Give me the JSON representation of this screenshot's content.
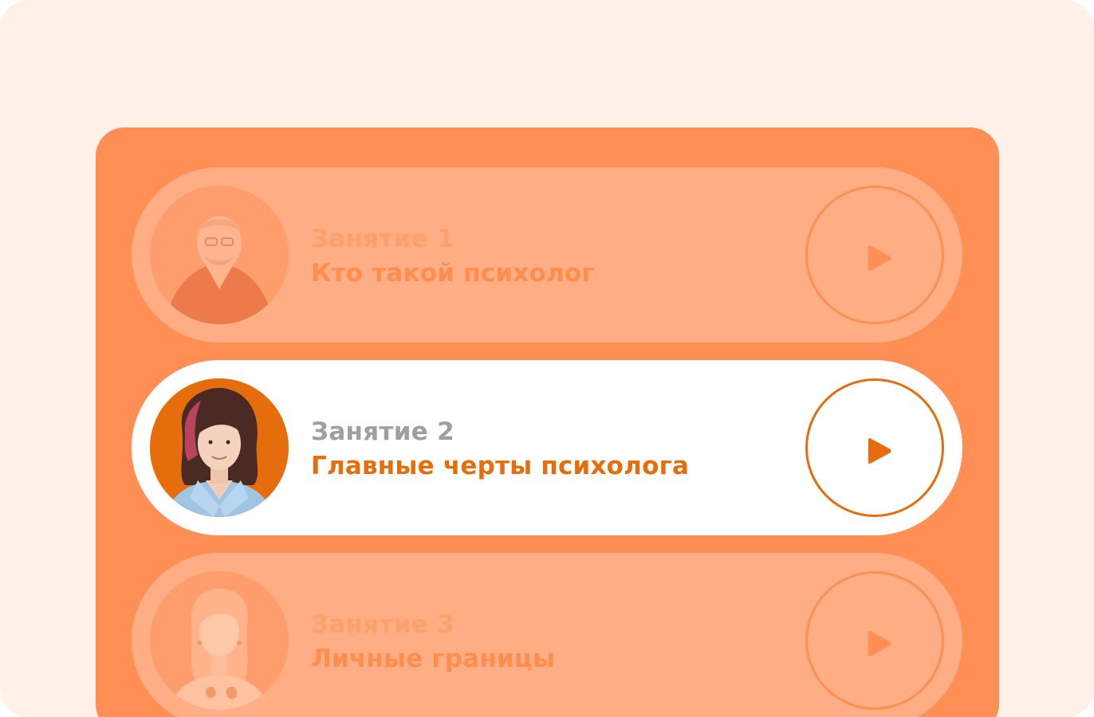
{
  "colors": {
    "page_background": "#fff0e8",
    "panel": "#ff8f55",
    "inactive_card": "#ffad84",
    "active_card": "#ffffff",
    "accent": "#e66d0c",
    "muted_label": "#a19e9b"
  },
  "lessons": [
    {
      "label": "Занятие 1",
      "title": "Кто такой психолог",
      "state": "inactive",
      "avatar": "lecturer-photo",
      "play_icon": "play-icon"
    },
    {
      "label": "Занятие 2",
      "title": "Главные черты психолога",
      "state": "active",
      "avatar": "lecturer-photo",
      "play_icon": "play-icon"
    },
    {
      "label": "Занятие 3",
      "title": "Личные границы",
      "state": "inactive",
      "avatar": "lecturer-photo",
      "play_icon": "play-icon"
    }
  ]
}
